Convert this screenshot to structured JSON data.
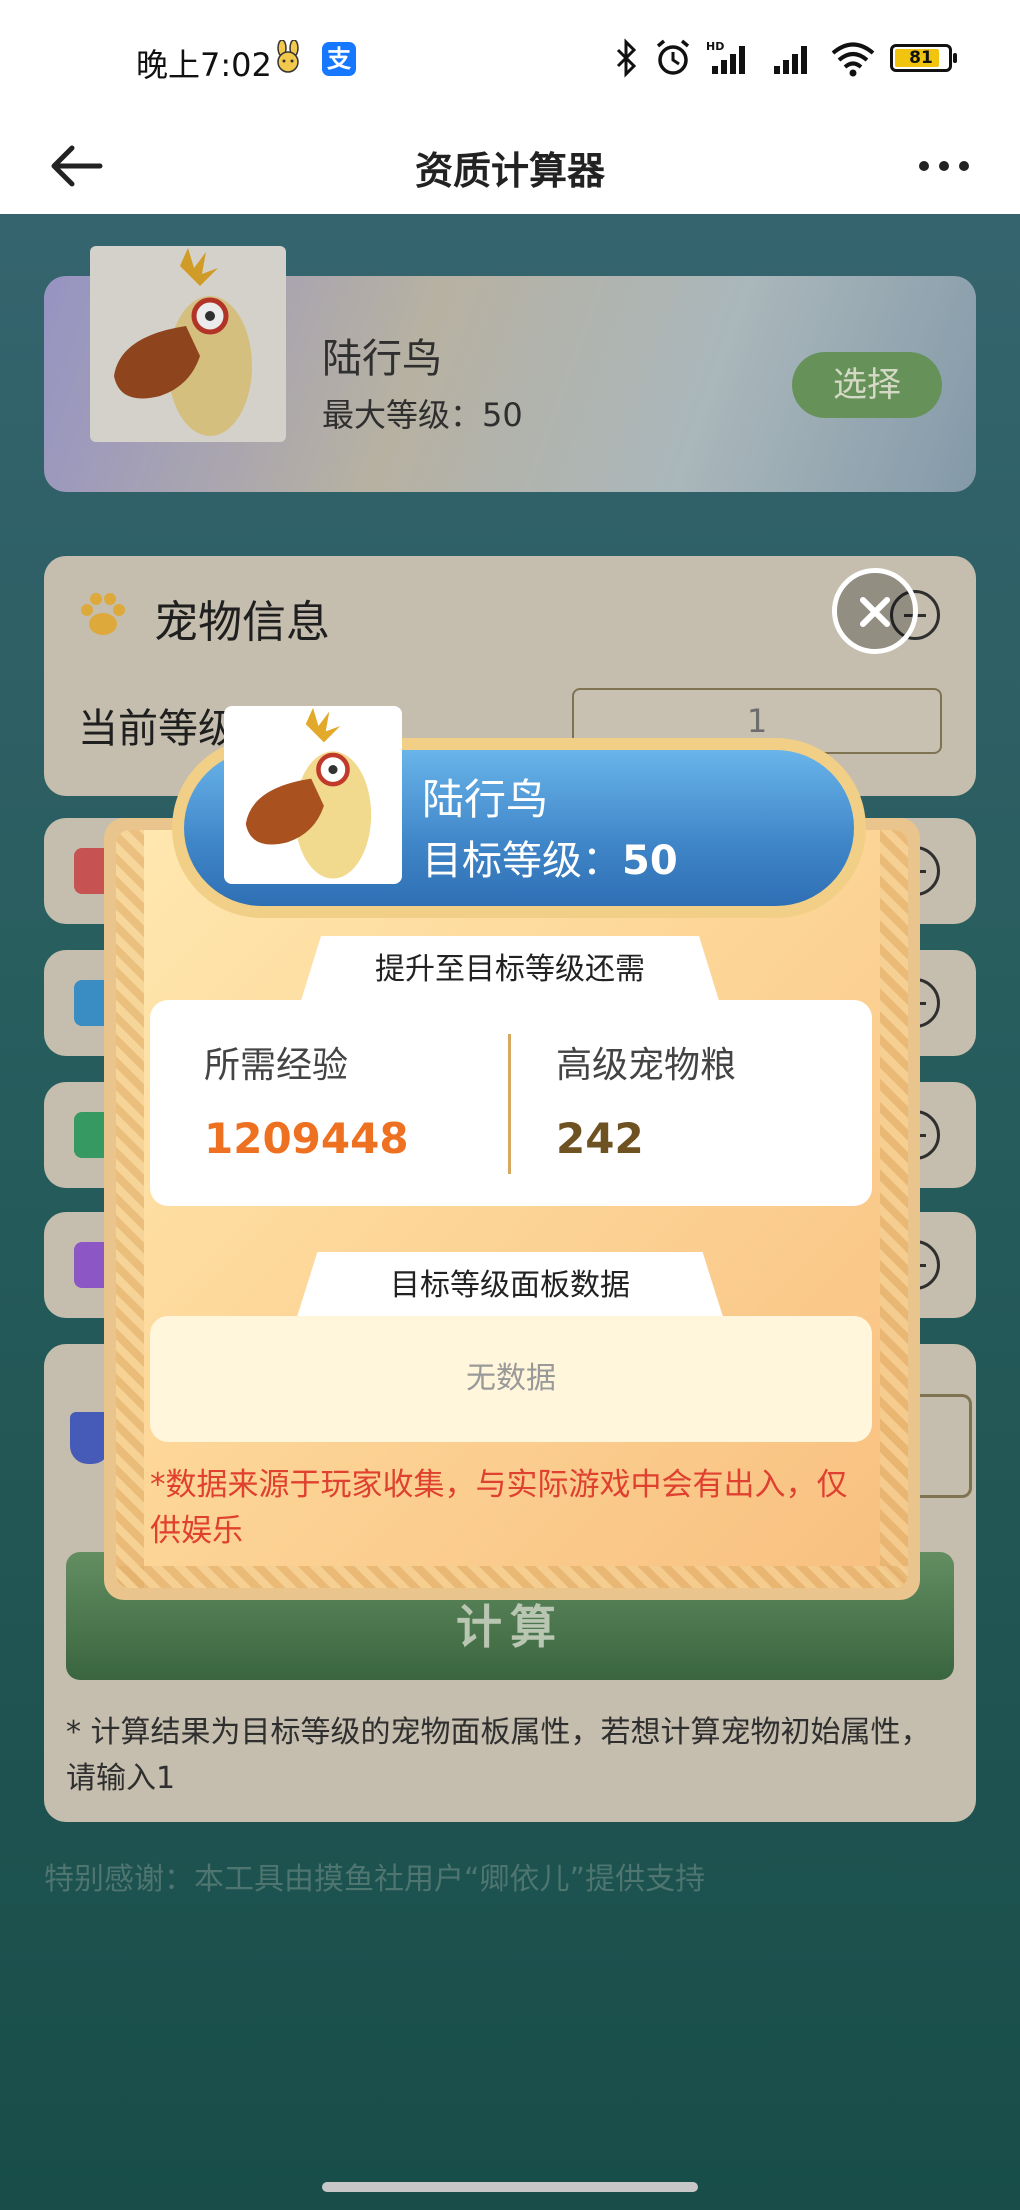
{
  "status_bar": {
    "time": "晚上7:02",
    "battery": "81",
    "icons": [
      "bunny-notification-icon",
      "alipay-icon",
      "bluetooth-icon",
      "alarm-icon",
      "hd-signal-icon",
      "signal-icon",
      "wifi-icon",
      "battery-icon"
    ]
  },
  "header": {
    "title": "资质计算器",
    "back_icon": "arrow-left-icon",
    "more_icon": "more-dots-icon"
  },
  "pet_card": {
    "name": "陆行鸟",
    "max_level": "最大等级：50",
    "select_button": "选择"
  },
  "pet_info": {
    "heading": "宠物信息",
    "current_level_label": "当前等级",
    "current_level_value": "1"
  },
  "calc_button": "计算",
  "calc_note": "* 计算结果为目标等级的宠物面板属性，若想计算宠物初始属性，请输入1",
  "thanks": "特别感谢：本工具由摸鱼社用户“卿依儿”提供支持",
  "modal": {
    "pet_name": "陆行鸟",
    "target_level_label": "目标等级：",
    "target_level_value": "50",
    "section1_title": "提升至目标等级还需",
    "exp_label": "所需经验",
    "exp_value": "1209448",
    "food_label": "高级宠物粮",
    "food_value": "242",
    "section2_title": "目标等级面板数据",
    "no_data": "无数据",
    "disclaimer": "*数据来源于玩家收集，与实际游戏中会有出入，仅供娱乐"
  },
  "colors": {
    "exp_value": "#ee7122",
    "food_value": "#6e5221",
    "disclaimer": "#e04030",
    "banner": "#3f86c8",
    "modal_bg": "#fdd89a"
  }
}
